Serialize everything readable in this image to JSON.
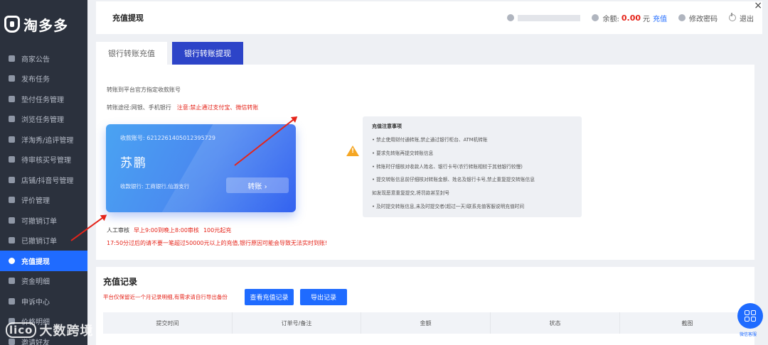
{
  "app": {
    "logo_text": "淘多多"
  },
  "sidebar": {
    "items": [
      {
        "label": "商家公告",
        "icon": "monitor-icon",
        "active": false
      },
      {
        "label": "发布任务",
        "icon": "document-icon",
        "active": false
      },
      {
        "label": "垫付任务管理",
        "icon": "card-icon",
        "active": false
      },
      {
        "label": "浏览任务管理",
        "icon": "eye-icon",
        "active": false
      },
      {
        "label": "洋淘秀/追评管理",
        "icon": "comment-icon",
        "active": false
      },
      {
        "label": "待审核买号管理",
        "icon": "user-icon",
        "active": false
      },
      {
        "label": "店铺/抖音号管理",
        "icon": "store-icon",
        "active": false
      },
      {
        "label": "评价管理",
        "icon": "star-icon",
        "active": false
      },
      {
        "label": "可撤销订单",
        "icon": "file-icon",
        "active": false
      },
      {
        "label": "已撤销订单",
        "icon": "file-cancel-icon",
        "active": false
      },
      {
        "label": "充值提现",
        "icon": "money-bag-icon",
        "active": true
      },
      {
        "label": "资金明细",
        "icon": "ledger-icon",
        "active": false
      },
      {
        "label": "申诉中心",
        "icon": "megaphone-icon",
        "active": false
      },
      {
        "label": "价格明细",
        "icon": "price-icon",
        "active": false
      },
      {
        "label": "邀请好友",
        "icon": "invite-icon",
        "active": false
      }
    ]
  },
  "header": {
    "title": "充值提现",
    "balance_label": "余额:",
    "balance_amount": "0.00",
    "balance_unit": "元",
    "recharge_label": "充值",
    "change_password_label": "修改密码",
    "logout_label": "退出",
    "close_symbol": "×"
  },
  "tabs": [
    {
      "label": "银行转账充值",
      "active": false
    },
    {
      "label": "银行转账提现",
      "active": true
    }
  ],
  "deposit": {
    "note1": "转账到平台官方指定收款账号",
    "note2_prefix": "转账途径:网银、手机银行",
    "note2_warning": "注意:禁止通过支付宝、微信转账",
    "card": {
      "account_label": "收款账号: 6212261405012395729",
      "holder_name": "苏鹏",
      "bank_label": "收款银行: 工商银行,仙游支行",
      "transfer_button": "转账 ›"
    },
    "review_prefix": "人工审核",
    "review_hours": "早上9:00到晚上8:00审核",
    "review_min": "100元起充",
    "cutoff_warning": "17:50分过后的请不要一笔超过50000元以上的充值,银行原因可能会导致无法实时到账!"
  },
  "notice": {
    "title": "充值注意事项",
    "lines": [
      "• 禁止使用财付通转账,禁止通过银行柜台、ATM机转账",
      "• 要求先转账再提交转账信息",
      "• 转账时仔细核对收款人姓名、银行卡号(农行转账相较于其他银行较慢)",
      "• 提交转账信息前仔细核对转账金额、姓名及银行卡号,禁止重复提交转账信息",
      "如发现恶意重复提交,将罚款甚至封号",
      "• 及时提交转账信息,未及时提交者(超过一天)联系充值客服说明充值时间"
    ]
  },
  "records": {
    "title": "充值记录",
    "note": "平台仅保留近一个月记录明细,有需求请自行导出备份",
    "view_button": "查看充值记录",
    "export_button": "导出记录",
    "columns": [
      "提交时间",
      "订单号/备注",
      "金额",
      "状态",
      "截图"
    ]
  },
  "watermark": {
    "logo": "lico",
    "text": "大数跨境"
  },
  "chat": {
    "label": "微信客服"
  },
  "colors": {
    "primary": "#1f6bff",
    "sidebar_bg": "#2b313d",
    "danger": "#e5241a",
    "tab_active": "#2d44c8"
  }
}
